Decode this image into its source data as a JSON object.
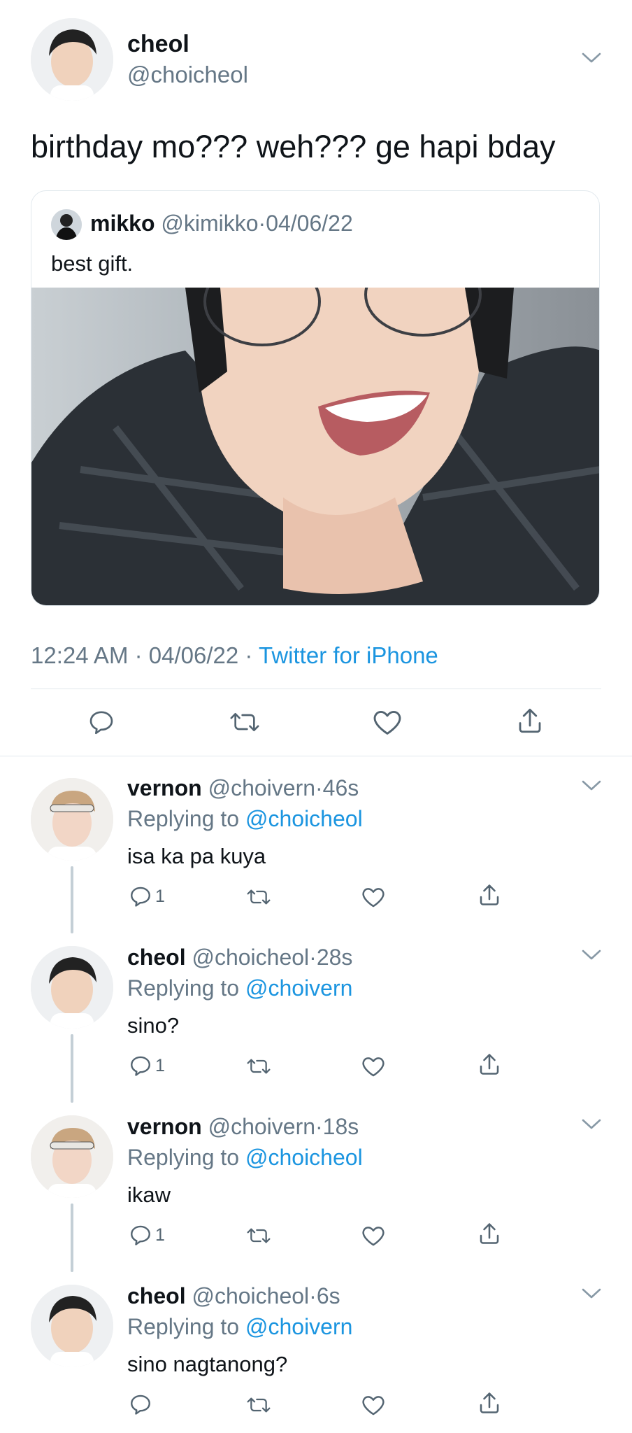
{
  "main_tweet": {
    "name": "cheol",
    "handle": "@choicheol",
    "text": "birthday mo??? weh??? ge hapi bday",
    "quoted": {
      "name": "mikko",
      "handle": "@kimikko",
      "date": "04/06/22",
      "text": "best gift."
    },
    "meta": {
      "time": "12:24 AM",
      "sep": "·",
      "date": "04/06/22",
      "source": "Twitter for iPhone"
    }
  },
  "replies": [
    {
      "name": "vernon",
      "handle": "@choivern",
      "time": "46s",
      "replying_prefix": "Replying to",
      "replying_to": "@choicheol",
      "text": "isa ka pa kuya",
      "reply_count": "1"
    },
    {
      "name": "cheol",
      "handle": "@choicheol",
      "time": "28s",
      "replying_prefix": "Replying to",
      "replying_to": "@choivern",
      "text": "sino?",
      "reply_count": "1"
    },
    {
      "name": "vernon",
      "handle": "@choivern",
      "time": "18s",
      "replying_prefix": "Replying to",
      "replying_to": "@choicheol",
      "text": "ikaw",
      "reply_count": "1"
    },
    {
      "name": "cheol",
      "handle": "@choicheol",
      "time": "6s",
      "replying_prefix": "Replying to",
      "replying_to": "@choivern",
      "text": "sino nagtanong?",
      "reply_count": ""
    }
  ],
  "colors": {
    "link": "#1b95e0",
    "muted": "#657786",
    "icon": "#536471",
    "thread_line": "#c4cfd6"
  },
  "icons": [
    "chevron-down-icon",
    "reply-icon",
    "retweet-icon",
    "like-icon",
    "share-icon"
  ]
}
